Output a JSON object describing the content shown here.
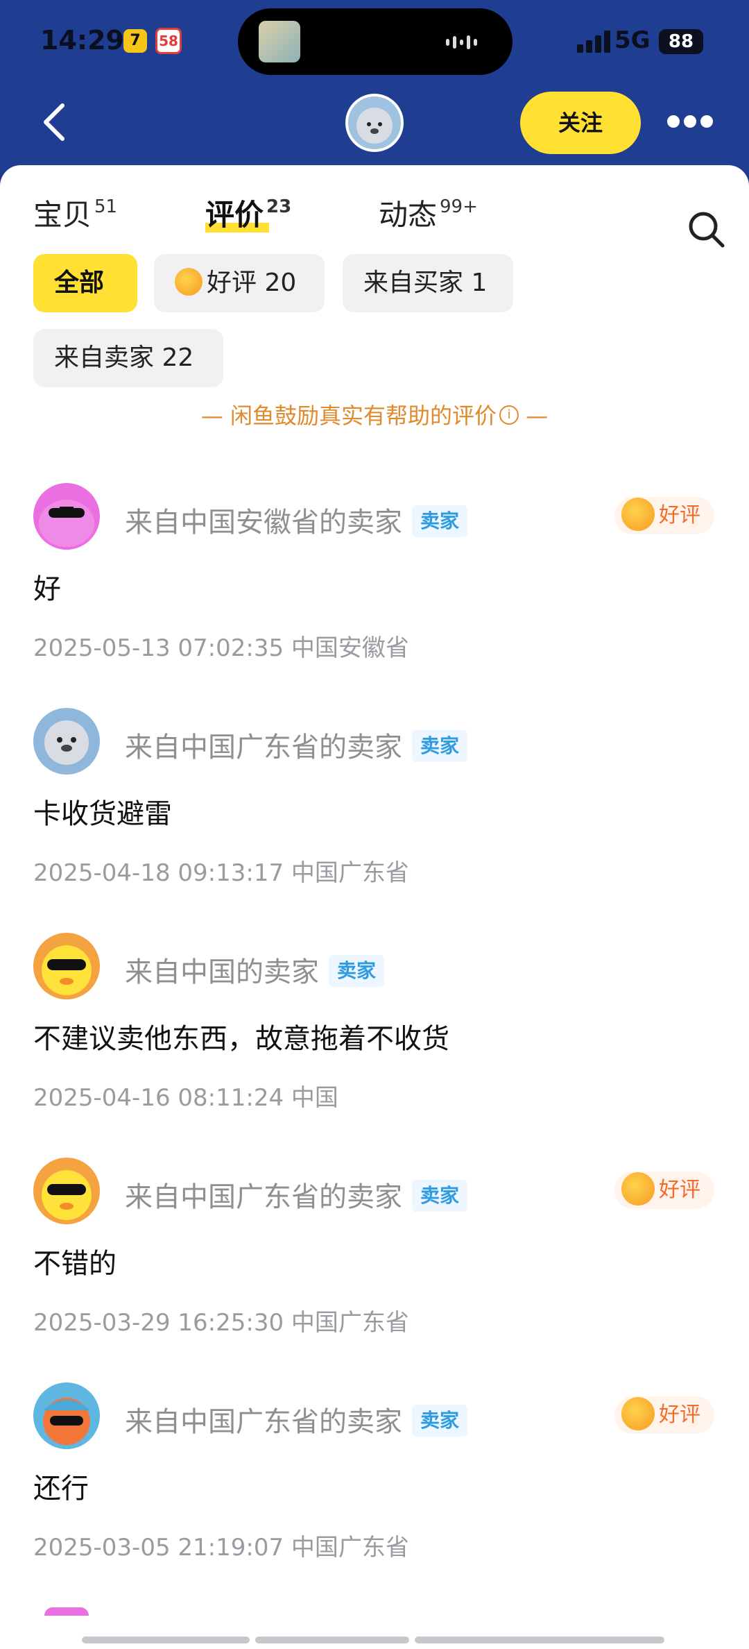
{
  "status_bar": {
    "time": "14:29",
    "app_icon_1": "7",
    "app_icon_2": "58",
    "network": "5G",
    "battery": "88"
  },
  "header": {
    "back_icon": "chevron-left-icon",
    "follow_label": "关注",
    "more_icon": "more-dots-icon"
  },
  "tabs": [
    {
      "label": "宝贝",
      "count": "51"
    },
    {
      "label": "评价",
      "count": "23"
    },
    {
      "label": "动态",
      "count": "99+"
    }
  ],
  "filters": {
    "all": "全部",
    "good": "好评 20",
    "from_buyer": "来自买家 1",
    "from_seller": "来自卖家 22"
  },
  "encourage_text": "— 闲鱼鼓励真实有帮助的评价",
  "encourage_suffix": " —",
  "reviews": [
    {
      "name": "来自中国安徽省的卖家",
      "badge": "卖家",
      "rating": "好评",
      "text": "好",
      "meta": "2025-05-13 07:02:35  中国安徽省"
    },
    {
      "name": "来自中国广东省的卖家",
      "badge": "卖家",
      "rating": "",
      "text": "卡收货避雷",
      "meta": "2025-04-18 09:13:17  中国广东省"
    },
    {
      "name": "来自中国的卖家",
      "badge": "卖家",
      "rating": "",
      "text": "不建议卖他东西，故意拖着不收货",
      "meta": "2025-04-16 08:11:24  中国"
    },
    {
      "name": "来自中国广东省的卖家",
      "badge": "卖家",
      "rating": "好评",
      "text": "不错的",
      "meta": "2025-03-29 16:25:30  中国广东省"
    },
    {
      "name": "来自中国广东省的卖家",
      "badge": "卖家",
      "rating": "好评",
      "text": "还行",
      "meta": "2025-03-05 21:19:07  中国广东省"
    }
  ],
  "colors": {
    "header_bg": "#1f3d91",
    "accent_yellow": "#ffe033",
    "seller_badge": "#2f9be0",
    "good_rating": "#f36b2a",
    "encourage": "#e08a2c"
  }
}
